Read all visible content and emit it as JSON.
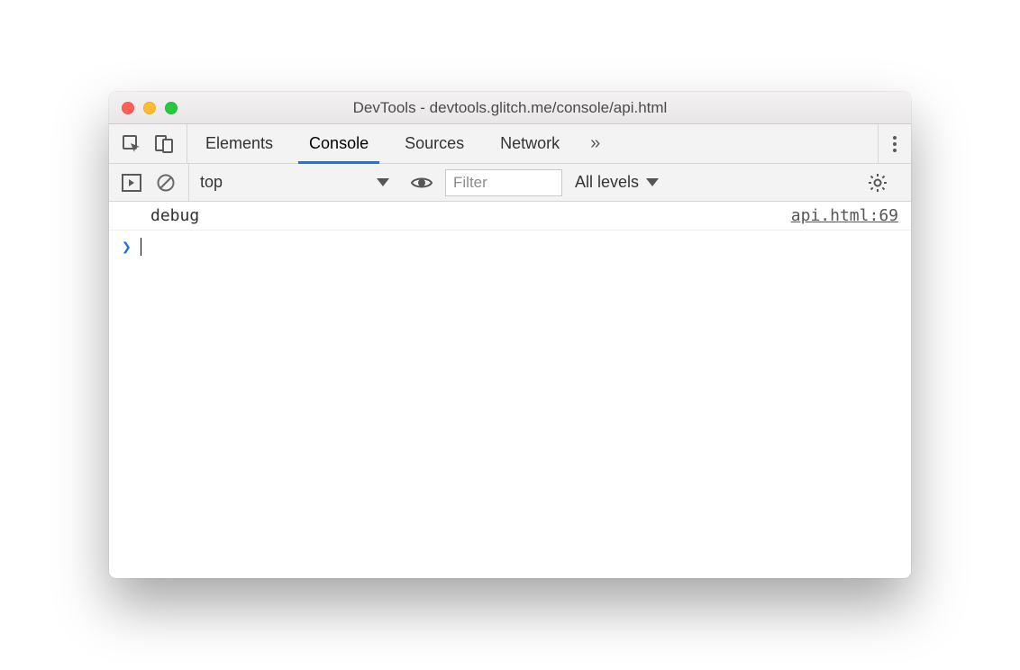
{
  "window": {
    "title": "DevTools - devtools.glitch.me/console/api.html"
  },
  "tabs": {
    "items": [
      "Elements",
      "Console",
      "Sources",
      "Network"
    ],
    "active": "Console",
    "overflow_glyph": "»"
  },
  "toolbar": {
    "context_label": "top",
    "filter_placeholder": "Filter",
    "levels_label": "All levels"
  },
  "console": {
    "log_message": "debug",
    "log_source": "api.html:69",
    "prompt_glyph": "❯"
  }
}
